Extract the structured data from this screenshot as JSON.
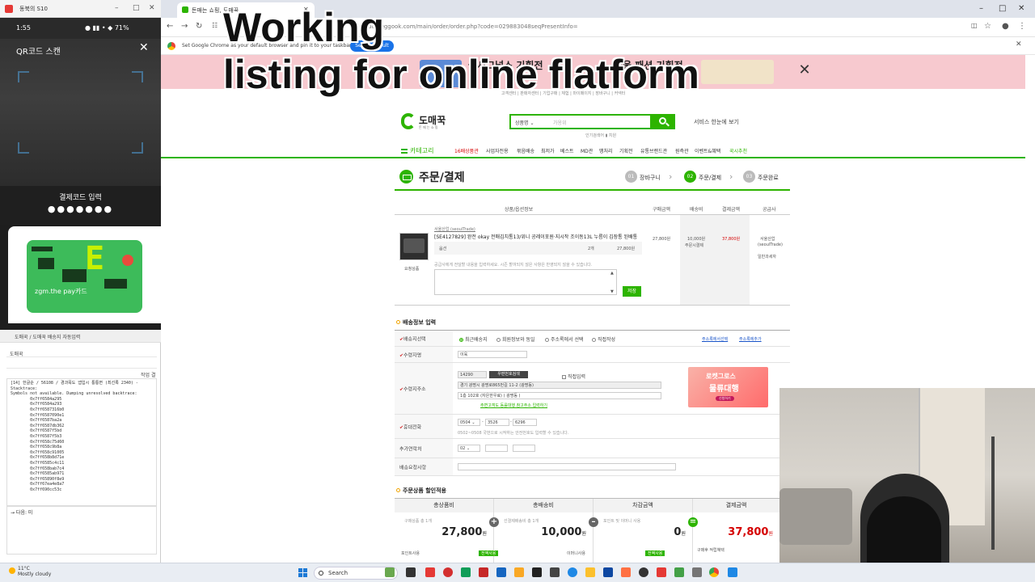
{
  "overlay": {
    "line1": "Working",
    "line2": "listing for online flatform"
  },
  "phone": {
    "window_title": "동북의 S10",
    "status_time": "1:55",
    "status_icons": "● ▮▮ • ◆ 71%",
    "qr_title": "QR코드 스캔",
    "paycode_label": "결제코드 입력",
    "paycode_dots": "●●●●●●●",
    "card_name": "zgm.the pay카드",
    "card_brand": "E"
  },
  "console": {
    "title": "도매꾹 / 도매꾹 배송지 자동입력",
    "field1": "도매꾹",
    "row_right": "작업 결",
    "log": "[14] 한글순 / 56108 / 경과목도 앱입시 통통면 (최선록 2340) -\nStacktrace:\nSymbols not available. Dumping unresolved backtrace:\n        0x7ff6584a295\n        0x7ff6584a293\n        0x7ff6587316b0\n        0x7ff6587090e1\n        0x7ff6587ba2a\n        0x7ff6587db362\n        0x7ff6587f5bd\n        0x7ff6587f5b3\n        0x7ff658c75d60\n        0x7ff658c9b8a\n        0x7ff658c91005\n        0x7ff658b8d71e\n        0x7ff6585c4c11\n        0x7ff658bab7c4\n        0x7ff6585ab971\n        0x7ff65890f8e9\n        0x7ff67ea4e8a7\n        0x7ff690cc53c",
    "bottom": "→ 다음: 미"
  },
  "browser": {
    "tab_title": "돈매는 쇼핑, 도매꾹",
    "url": "domeggook.com/main/order/order.php?code=029883048seqPresentInfo=",
    "infobar_msg": "Set Google Chrome as your default browser and pin it to your taskbar",
    "infobar_btn": "Set as default"
  },
  "banner": {
    "center_text": "꾹시그널스 기획전",
    "right_text": "겨울 패션 기획전"
  },
  "utilmenu": "고객센터 | 판매자센터 | 기업구매 | 체험 | 마이페이지 | 장바구니 | 커넥터",
  "site": {
    "logo_name": "도매꾹",
    "logo_sub": "돈 매 는 쇼 핑",
    "search_select": "상품명",
    "search_placeholder": "가옹위",
    "service_link": "서비스 한눈에 보기",
    "popular": "인기검색어  ▮  치원"
  },
  "gnb": {
    "category": "카테고리",
    "items": [
      {
        "label": "16배상품관",
        "color": "#d50000"
      },
      {
        "label": "사업자전용",
        "color": "#333"
      },
      {
        "label": "묶음배송",
        "color": "#333"
      },
      {
        "label": "최저가",
        "color": "#333"
      },
      {
        "label": "베스트",
        "color": "#333"
      },
      {
        "label": "MD관",
        "color": "#333"
      },
      {
        "label": "땡처리",
        "color": "#333"
      },
      {
        "label": "기획전",
        "color": "#333"
      },
      {
        "label": "유통브랜드관",
        "color": "#333"
      },
      {
        "label": "원측관",
        "color": "#333"
      },
      {
        "label": "이벤트&혜택",
        "color": "#333"
      },
      {
        "label": "꾹시추천",
        "color": "#2db400"
      }
    ]
  },
  "order": {
    "title": "주문/결제",
    "steps": [
      {
        "num": "01",
        "label": "장바구니"
      },
      {
        "num": "02",
        "label": "주문/결제"
      },
      {
        "num": "03",
        "label": "주문완료"
      }
    ],
    "table_head": [
      "상품/옵션정보",
      "구매금액",
      "배송비",
      "결제금액",
      "공급사"
    ],
    "product": {
      "seller": "서울산업 (seoulTrade)",
      "name": "[SE4127829] 완전 okay 전매김치통13/위니 공레이포원·지시작 조이동13L 누름이 김장통 된배통",
      "option_label": "옵션",
      "option_qty": "2개",
      "option_price": "27,800원",
      "price": "27,800원",
      "ship": "10,000원",
      "ship_note": "주문시결제",
      "pay": "37,800원",
      "supplier": "서울산업",
      "supplier_id": "(seoulTrade)",
      "supplier_type": "일반과세자",
      "memo_label": "요청상품",
      "memo_note": "공급사에게 전달할 내용을 입력하세요. 시즌 할여되지 않은 사항은 반영되지 않을 수 있습니다.",
      "save": "저장"
    }
  },
  "shipping": {
    "title": "배송정보 입력",
    "select_label": "배송지선택",
    "radios": [
      "최근배송지",
      "회원정보와 동일",
      "주소록에서 선택",
      "직접작성"
    ],
    "link1": "주소록에서선택",
    "link2": "주소록에추가",
    "recipient_label": "수령자명",
    "recipient_value": "이육",
    "address_label": "수령지주소",
    "zip": "14290",
    "zip_btn": "우편번호검색",
    "direct_input": "직접입력",
    "addr1": "경기 광명시 광명로865번길 11-2 (광명동)",
    "addr2": "1층 102호 (자은한우료) ( 광명동 )",
    "addr_link": "주변고객도 동률대행 참고주소 입력하기",
    "phone_label": "휴대전화",
    "phone1": "0504",
    "phone2": "3526",
    "phone3": "6296",
    "phone_note": "0502~0508 국번으로 시작하는 안전번호도 입력할 수 있습니다.",
    "extra_label": "추가연락처",
    "extra1": "02",
    "memo_label": "배송요청사항",
    "ad_line1": "로켓그로스",
    "ad_line2": "물류대행",
    "ad_btn": "신청하기"
  },
  "discount": {
    "title": "주문상품 할인적용",
    "cols": [
      {
        "head": "총상품비",
        "sub": "구매상품 총 1개",
        "value": "27,800",
        "unit": "원",
        "red": false
      },
      {
        "head": "총배송비",
        "sub": "선결제배송비 총 1개",
        "value": "10,000",
        "unit": "원",
        "red": false
      },
      {
        "head": "차감금액",
        "sub": "포인트 및 이머니 사용",
        "value": "0",
        "unit": "원",
        "red": false
      },
      {
        "head": "결제금액",
        "sub": "",
        "value": "37,800",
        "unit": "원",
        "red": true
      }
    ],
    "point_label": "포인트사용",
    "emoney_label": "이머니사용",
    "use_btn": "전액사용",
    "pay_note": "구매후 적립혜택"
  },
  "taskbar": {
    "weather_temp": "11°C",
    "weather_desc": "Mostly cloudy",
    "search": "Search"
  }
}
